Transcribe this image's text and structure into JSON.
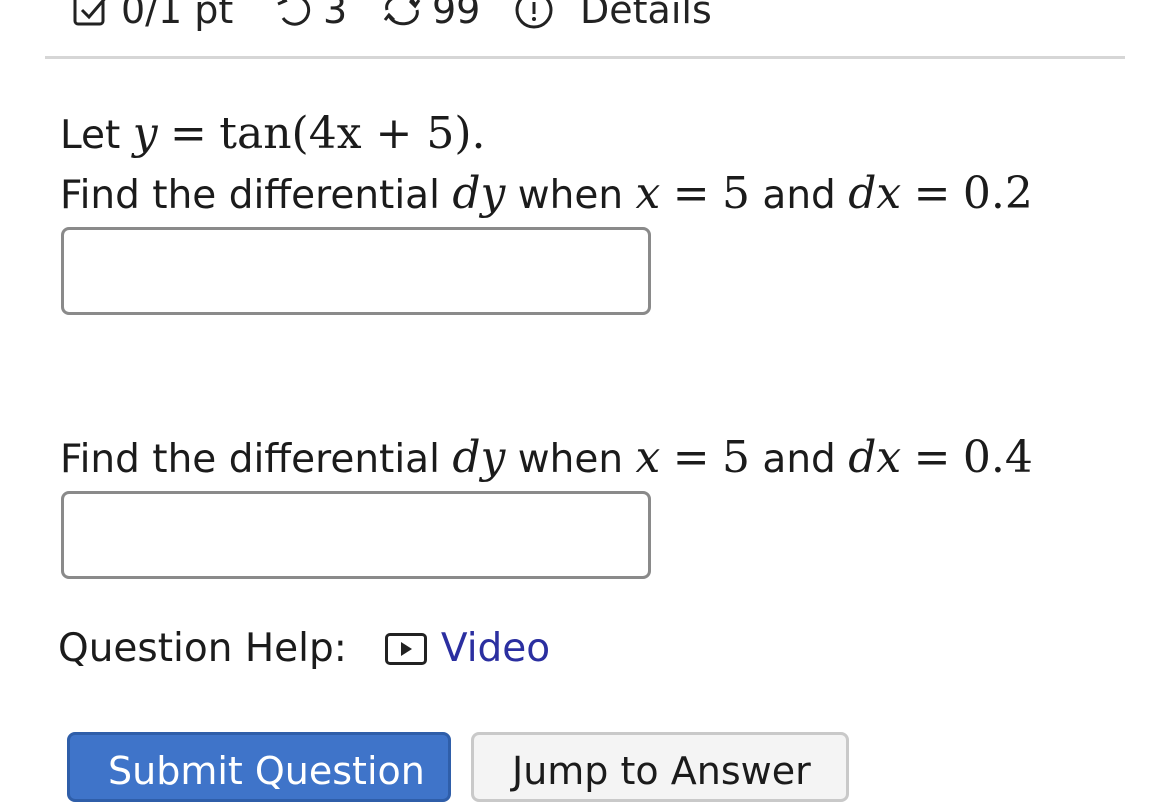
{
  "header": {
    "points": "0/1 pt",
    "retries": "3",
    "attempts": "99",
    "details": "Details"
  },
  "question": {
    "let_word": "Let",
    "func_lhs": "y",
    "func_eq": "=",
    "func_rhs": "tan(4x + 5).",
    "parts": [
      {
        "find": "Find the differential",
        "dy": "dy",
        "when": "when",
        "x_var": "x",
        "eq1": "=",
        "x_val": "5",
        "and": "and",
        "dx": "dx",
        "eq2": "=",
        "dx_val": "0.2",
        "answer_value": ""
      },
      {
        "find": "Find the differential",
        "dy": "dy",
        "when": "when",
        "x_var": "x",
        "eq1": "=",
        "x_val": "5",
        "and": "and",
        "dx": "dx",
        "eq2": "=",
        "dx_val": "0.4",
        "answer_value": ""
      }
    ]
  },
  "help": {
    "label": "Question Help:",
    "video_label": "Video"
  },
  "buttons": {
    "submit": "Submit Question",
    "jump": "Jump to Answer"
  },
  "colors": {
    "link": "#2b2fa0",
    "submit_bg": "#3f74c9",
    "divider": "#d6d6d6"
  },
  "icons": [
    "checkbox-icon",
    "retry-icon",
    "attempts-icon",
    "info-icon",
    "video-play-icon"
  ]
}
